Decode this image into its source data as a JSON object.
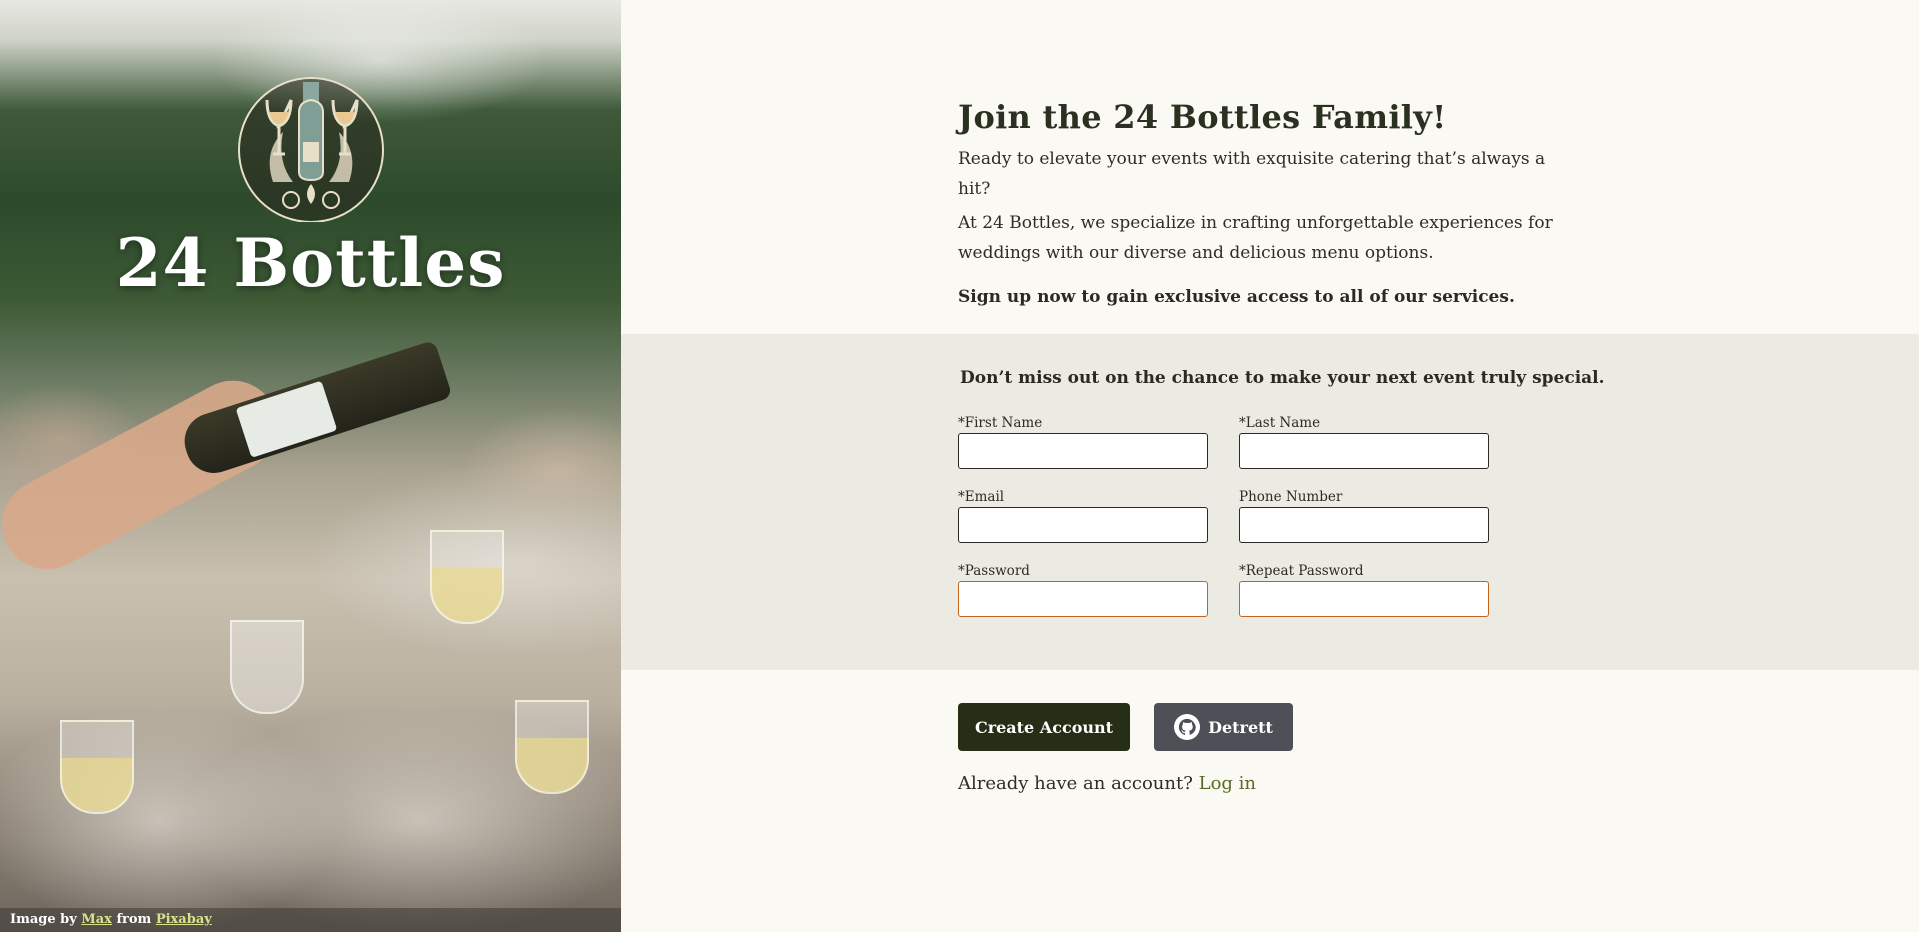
{
  "hero": {
    "brand": "24 Bottles",
    "credit": {
      "prefix": "Image by",
      "author": "Max",
      "middle": "from",
      "source": "Pixabay"
    }
  },
  "intro": {
    "heading": "Join the 24 Bottles Family!",
    "line1": "Ready to elevate your events with exquisite catering that’s always a hit?",
    "line2": "At 24 Bottles, we specialize in crafting unforgettable experiences for weddings with our diverse and delicious menu options.",
    "cta": "Sign up now to gain exclusive access to all of our services."
  },
  "form": {
    "tagline": "Don’t miss out on the chance to make your next event truly special.",
    "fields": {
      "first_name": {
        "label": "*First Name",
        "value": ""
      },
      "last_name": {
        "label": "*Last Name",
        "value": ""
      },
      "email": {
        "label": "*Email",
        "value": ""
      },
      "phone": {
        "label": "Phone Number",
        "value": ""
      },
      "password": {
        "label": "*Password",
        "value": ""
      },
      "repeat_password": {
        "label": "*Repeat Password",
        "value": ""
      }
    }
  },
  "actions": {
    "create_label": "Create Account",
    "github_label": "Detrett",
    "github_icon": "github-icon"
  },
  "login": {
    "prompt": "Already have an account?",
    "link": "Log in"
  },
  "colors": {
    "primary": "#262f15",
    "secondary_button": "#4d5056",
    "band": "#ebeae3",
    "page_bg": "#faf9f3",
    "link": "#5b6b22",
    "password_border": "#c2631f"
  }
}
